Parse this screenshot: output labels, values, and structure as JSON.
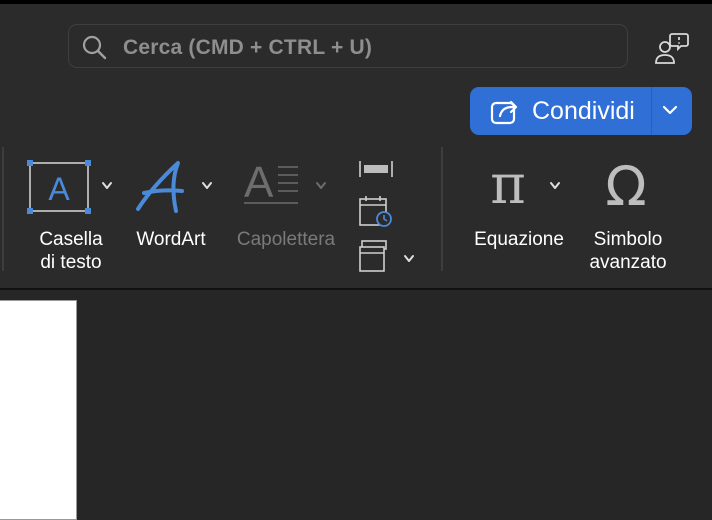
{
  "search": {
    "placeholder": "Cerca (CMD + CTRL + U)"
  },
  "share": {
    "label": "Condividi"
  },
  "ribbon": {
    "tools": [
      {
        "label_line1": "Casella",
        "label_line2": "di testo"
      },
      {
        "label_line1": "WordArt"
      },
      {
        "label_line1": "Capolettera"
      },
      {
        "label_line1": "Equazione"
      },
      {
        "label_line1": "Simbolo",
        "label_line2": "avanzato"
      }
    ],
    "text_box_glyph": "A",
    "wordart_glyph": "A",
    "dropcap_glyph": "A",
    "equation_glyph": "π",
    "symbol_glyph": "Ω"
  },
  "colors": {
    "accent": "#2f6fd6",
    "icon_blue": "#4a8ad8",
    "icon_gray": "#bdbdbd",
    "disabled": "#6d6d6d"
  }
}
